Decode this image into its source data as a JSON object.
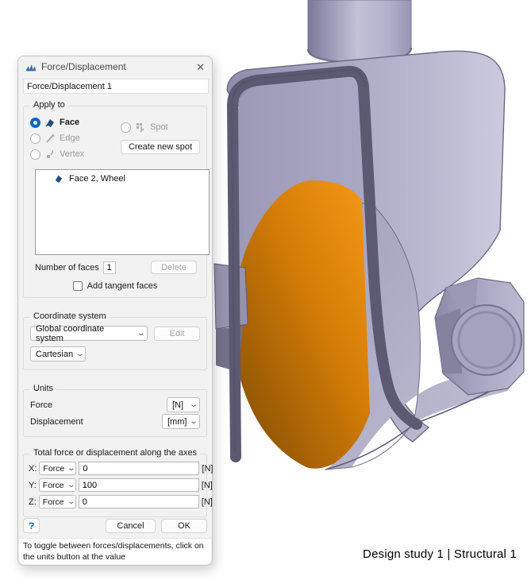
{
  "dialog": {
    "title": "Force/Displacement",
    "close_glyph": "✕",
    "name_value": "Force/Displacement 1",
    "apply_to": {
      "label": "Apply to",
      "options": [
        {
          "label": "Face"
        },
        {
          "label": "Edge"
        },
        {
          "label": "Vertex"
        },
        {
          "label": "Spot"
        }
      ],
      "create_new_spot_label": "Create new spot",
      "list_items": [
        {
          "label": "Face 2, Wheel"
        }
      ],
      "number_of_faces_label": "Number of faces",
      "number_of_faces_value": "1",
      "delete_label": "Delete",
      "add_tangent_label": "Add tangent faces"
    },
    "coordinate_system": {
      "label": "Coordinate system",
      "selected_system": "Global coordinate system",
      "edit_label": "Edit",
      "selected_type": "Cartesian",
      "chevron": "⌄"
    },
    "units": {
      "label": "Units",
      "force_label": "Force",
      "force_unit": "[N]",
      "displacement_label": "Displacement",
      "displacement_unit": "[mm]"
    },
    "axes": {
      "label": "Total force or displacement along the axes",
      "rows": [
        {
          "axis": "X:",
          "mode": "Force",
          "value": "0",
          "unit": "[N]"
        },
        {
          "axis": "Y:",
          "mode": "Force",
          "value": "100",
          "unit": "[N]"
        },
        {
          "axis": "Z:",
          "mode": "Force",
          "value": "0",
          "unit": "[N]"
        }
      ]
    },
    "help_label": "?",
    "cancel_label": "Cancel",
    "ok_label": "OK",
    "footer_text": "To toggle between forces/displacements, click on the units button at the value"
  },
  "viewport": {
    "status_text": "Design study 1 | Structural 1",
    "colors": {
      "fork_body": "#b4b2cc",
      "fork_light": "#c9c8db",
      "fork_dark_edge": "#5c5a72",
      "wheel_tread_bright": "#f49a17",
      "wheel_tread_dark": "#7c4a03",
      "background": "#ffffff",
      "accent_blue": "#0067c0"
    }
  }
}
